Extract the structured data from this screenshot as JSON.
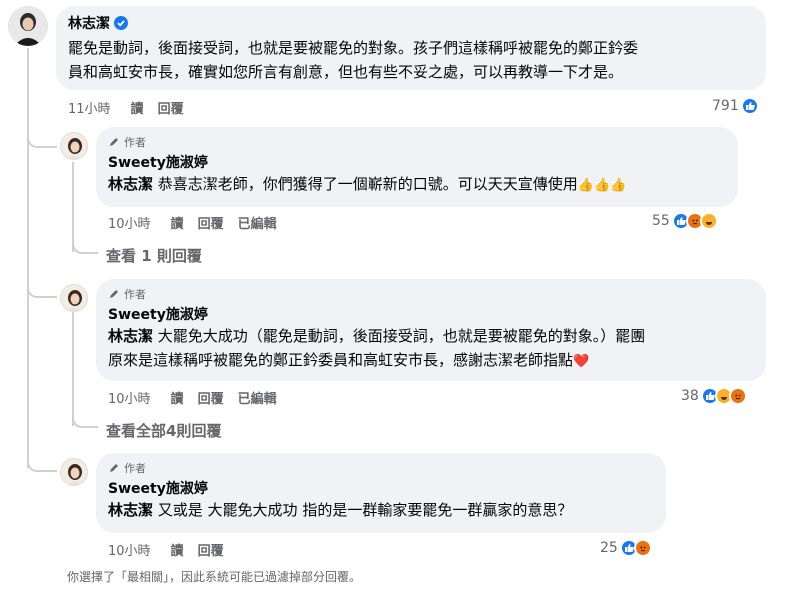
{
  "main_comment": {
    "author": "林志潔",
    "text": "罷免是動詞，後面接受詞，也就是要被罷免的對象。孩子們這樣稱呼被罷免的鄭正鈐委員和高虹安市長，確實如您所言有創意，但也有些不妥之處，可以再教導一下才是。",
    "line1": "罷免是動詞，後面接受詞，也就是要被罷免的對象。孩子們這樣稱呼被罷免的鄭正鈐委",
    "line2": "員和高虹安市長，確實如您所言有創意，但也有些不妥之處，可以再教導一下才是。",
    "time": "11小時",
    "read": "讀",
    "reply": "回覆",
    "reaction_count": "791"
  },
  "replies": [
    {
      "author_tag": "作者",
      "author": "Sweety施淑婷",
      "mention": "林志潔",
      "line1": " 恭喜志潔老師，你們獲得了一個嶄新的口號。可以天天宣傳使用",
      "line1_emoji": "👍👍👍",
      "time": "10小時",
      "read": "讀",
      "reply": "回覆",
      "edited": "已編輯",
      "reaction_count": "55",
      "view_more": "查看 1 則回覆"
    },
    {
      "author_tag": "作者",
      "author": "Sweety施淑婷",
      "mention": "林志潔",
      "line1": " 大罷免大成功（罷免是動詞，後面接受詞，也就是要被罷免的對象。）罷團",
      "line2": "原來是這樣稱呼被罷免的鄭正鈐委員和高虹安市長，感謝志潔老師指點",
      "line2_emoji": "❤️",
      "time": "10小時",
      "read": "讀",
      "reply": "回覆",
      "edited": "已編輯",
      "reaction_count": "38",
      "view_more": "查看全部4則回覆"
    },
    {
      "author_tag": "作者",
      "author": "Sweety施淑婷",
      "mention": "林志潔",
      "line1": " 又或是 大罷免大成功 指的是一群輸家要罷免一群贏家的意思？",
      "time": "10小時",
      "read": "讀",
      "reply": "回覆",
      "reaction_count": "25"
    }
  ],
  "footer": "你選擇了「最相關」，因此系統可能已過濾掉部分回覆。",
  "colors": {
    "like": "#1877f2",
    "angry": "#e9710f",
    "haha": "#f7b125",
    "bubble": "#f0f2f5",
    "meta": "#65676b"
  }
}
